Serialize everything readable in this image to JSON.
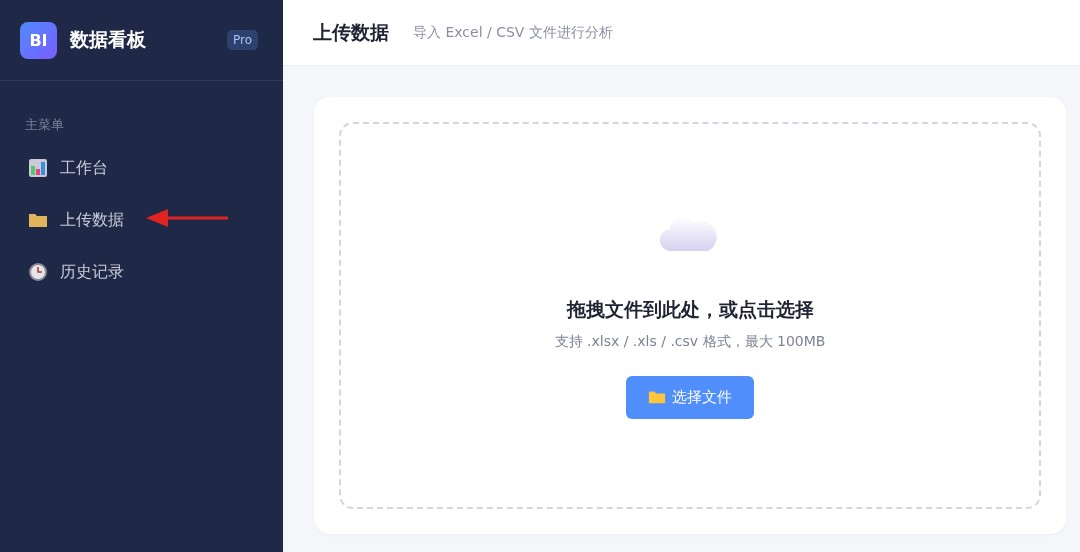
{
  "sidebar": {
    "logo": "BI",
    "title": "数据看板",
    "badge": "Pro",
    "section_label": "主菜单",
    "items": [
      {
        "label": "工作台",
        "kind": "dashboard",
        "selected": false
      },
      {
        "label": "上传数据",
        "kind": "folder",
        "selected": false
      },
      {
        "label": "历史记录",
        "kind": "clock",
        "selected": false
      }
    ]
  },
  "header": {
    "title": "上传数据",
    "subtitle": "导入 Excel / CSV 文件进行分析"
  },
  "dropzone": {
    "title": "拖拽文件到此处，或点击选择",
    "hint": "支持 .xlsx / .xls / .csv 格式，最大 100MB",
    "button": "选择文件"
  }
}
